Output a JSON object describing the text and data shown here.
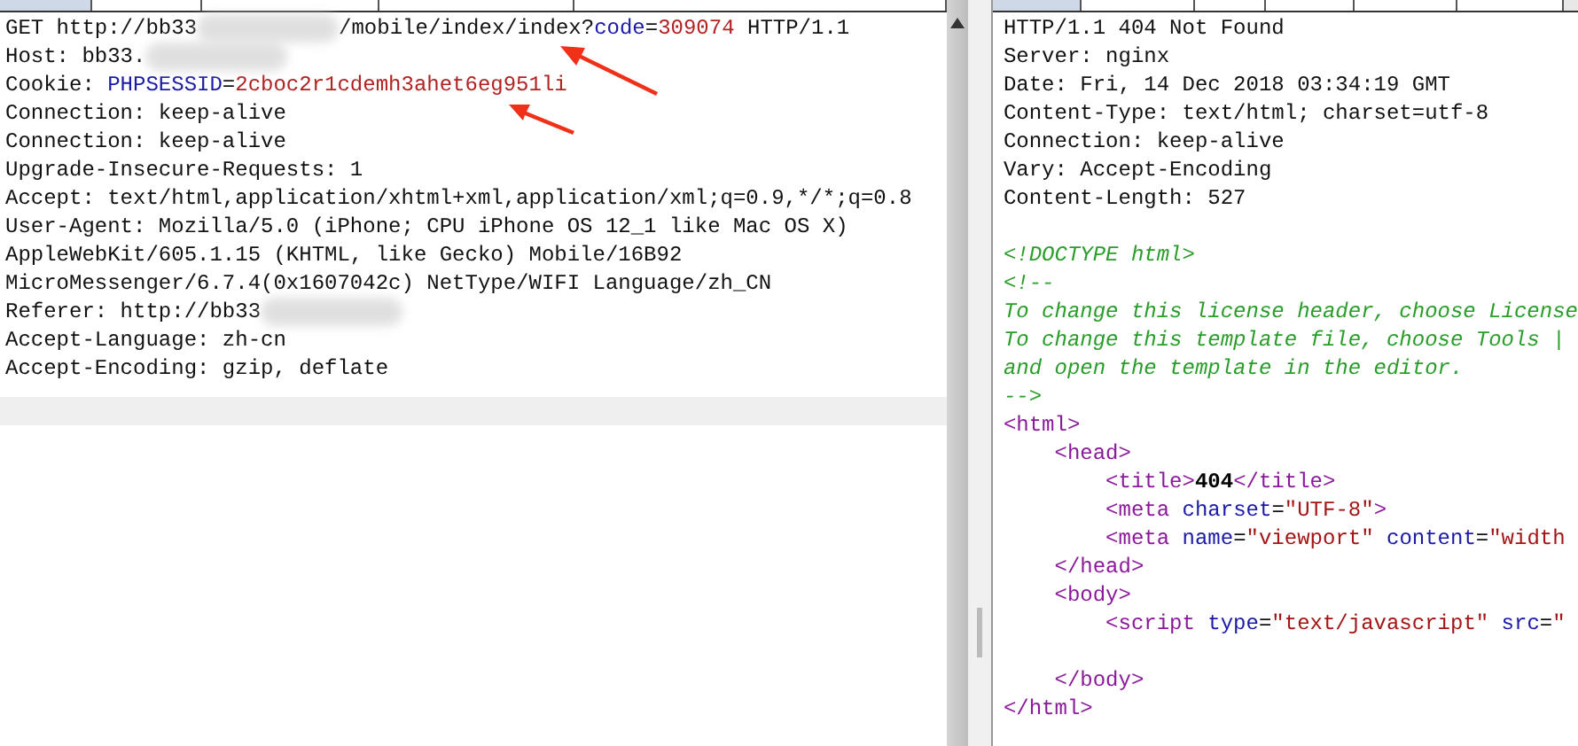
{
  "request": {
    "tabs": [
      {
        "selected": true
      },
      {
        "selected": false
      },
      {
        "selected": false
      },
      {
        "selected": false
      },
      {
        "selected": false
      }
    ],
    "lines": [
      {
        "kind": "code",
        "segments": [
          {
            "kind": "plain",
            "text": "GET http://bb33"
          },
          {
            "kind": "redacted"
          },
          {
            "kind": "plain",
            "text": "/mobile/index/index?"
          },
          {
            "kind": "name",
            "text": "code"
          },
          {
            "kind": "plain",
            "text": "="
          },
          {
            "kind": "value",
            "text": "309074"
          },
          {
            "kind": "plain",
            "text": " HTTP/1.1"
          }
        ]
      },
      {
        "kind": "code",
        "segments": [
          {
            "kind": "plain",
            "text": "Host: bb33."
          },
          {
            "kind": "redacted"
          }
        ]
      },
      {
        "kind": "code",
        "segments": [
          {
            "kind": "plain",
            "text": "Cookie: "
          },
          {
            "kind": "name",
            "text": "PHPSESSID"
          },
          {
            "kind": "plain",
            "text": "="
          },
          {
            "kind": "value",
            "text": "2cboc2r1cdemh3ahet6eg951li"
          }
        ]
      },
      {
        "kind": "code",
        "segments": [
          {
            "kind": "plain",
            "text": "Connection: keep-alive"
          }
        ]
      },
      {
        "kind": "code",
        "segments": [
          {
            "kind": "plain",
            "text": "Connection: keep-alive"
          }
        ]
      },
      {
        "kind": "code",
        "segments": [
          {
            "kind": "plain",
            "text": "Upgrade-Insecure-Requests: 1"
          }
        ]
      },
      {
        "kind": "code",
        "segments": [
          {
            "kind": "plain",
            "text": "Accept: text/html,application/xhtml+xml,application/xml;q=0.9,*/*;q=0.8"
          }
        ]
      },
      {
        "kind": "code",
        "segments": [
          {
            "kind": "plain",
            "text": "User-Agent: Mozilla/5.0 (iPhone; CPU iPhone OS 12_1 like Mac OS X)"
          }
        ]
      },
      {
        "kind": "code",
        "segments": [
          {
            "kind": "plain",
            "text": "AppleWebKit/605.1.15 (KHTML, like Gecko) Mobile/16B92"
          }
        ]
      },
      {
        "kind": "code",
        "segments": [
          {
            "kind": "plain",
            "text": "MicroMessenger/6.7.4(0x1607042c) NetType/WIFI Language/zh_CN"
          }
        ]
      },
      {
        "kind": "code",
        "segments": [
          {
            "kind": "plain",
            "text": "Referer: http://bb33"
          },
          {
            "kind": "redacted"
          }
        ]
      },
      {
        "kind": "code",
        "segments": [
          {
            "kind": "plain",
            "text": "Accept-Language: zh-cn"
          }
        ]
      },
      {
        "kind": "code",
        "segments": [
          {
            "kind": "plain",
            "text": "Accept-Encoding: gzip, deflate"
          }
        ]
      }
    ]
  },
  "response": {
    "tabs": [
      {
        "selected": true
      },
      {
        "selected": false
      },
      {
        "selected": false
      },
      {
        "selected": false
      },
      {
        "selected": false
      },
      {
        "selected": false
      }
    ],
    "lines": [
      {
        "kind": "code",
        "segments": [
          {
            "kind": "plain",
            "text": "HTTP/1.1 404 Not Found"
          }
        ]
      },
      {
        "kind": "code",
        "segments": [
          {
            "kind": "plain",
            "text": "Server: nginx"
          }
        ]
      },
      {
        "kind": "code",
        "segments": [
          {
            "kind": "plain",
            "text": "Date: Fri, 14 Dec 2018 03:34:19 GMT"
          }
        ]
      },
      {
        "kind": "code",
        "segments": [
          {
            "kind": "plain",
            "text": "Content-Type: text/html; charset=utf-8"
          }
        ]
      },
      {
        "kind": "code",
        "segments": [
          {
            "kind": "plain",
            "text": "Connection: keep-alive"
          }
        ]
      },
      {
        "kind": "code",
        "segments": [
          {
            "kind": "plain",
            "text": "Vary: Accept-Encoding"
          }
        ]
      },
      {
        "kind": "code",
        "segments": [
          {
            "kind": "plain",
            "text": "Content-Length: 527"
          }
        ]
      },
      {
        "kind": "blank"
      },
      {
        "kind": "code",
        "segments": [
          {
            "kind": "comment",
            "text": "<!DOCTYPE html>"
          }
        ]
      },
      {
        "kind": "code",
        "segments": [
          {
            "kind": "comment",
            "text": "<!--"
          }
        ]
      },
      {
        "kind": "code",
        "segments": [
          {
            "kind": "comment",
            "text": "To change this license header, choose License"
          }
        ]
      },
      {
        "kind": "code",
        "segments": [
          {
            "kind": "comment",
            "text": "To change this template file, choose Tools |"
          }
        ]
      },
      {
        "kind": "code",
        "segments": [
          {
            "kind": "comment",
            "text": "and open the template in the editor."
          }
        ]
      },
      {
        "kind": "code",
        "segments": [
          {
            "kind": "comment",
            "text": "-->"
          }
        ]
      },
      {
        "kind": "code",
        "segments": [
          {
            "kind": "tag",
            "text": "<html>"
          }
        ]
      },
      {
        "kind": "code",
        "segments": [
          {
            "kind": "tag",
            "text": "    <head>"
          }
        ]
      },
      {
        "kind": "code",
        "segments": [
          {
            "kind": "tag",
            "text": "        <title>"
          },
          {
            "kind": "bold",
            "text": "404"
          },
          {
            "kind": "tag",
            "text": "</title>"
          }
        ]
      },
      {
        "kind": "code",
        "segments": [
          {
            "kind": "tag",
            "text": "        <meta "
          },
          {
            "kind": "attr",
            "text": "charset"
          },
          {
            "kind": "plain",
            "text": "="
          },
          {
            "kind": "string",
            "text": "\"UTF-8\""
          },
          {
            "kind": "tag",
            "text": ">"
          }
        ]
      },
      {
        "kind": "code",
        "segments": [
          {
            "kind": "tag",
            "text": "        <meta "
          },
          {
            "kind": "attr",
            "text": "name"
          },
          {
            "kind": "plain",
            "text": "="
          },
          {
            "kind": "string",
            "text": "\"viewport\""
          },
          {
            "kind": "attr",
            "text": " content"
          },
          {
            "kind": "plain",
            "text": "="
          },
          {
            "kind": "string",
            "text": "\"width"
          }
        ]
      },
      {
        "kind": "code",
        "segments": [
          {
            "kind": "tag",
            "text": "    </head>"
          }
        ]
      },
      {
        "kind": "code",
        "segments": [
          {
            "kind": "tag",
            "text": "    <body>"
          }
        ]
      },
      {
        "kind": "code",
        "segments": [
          {
            "kind": "tag",
            "text": "        <script "
          },
          {
            "kind": "attr",
            "text": "type"
          },
          {
            "kind": "plain",
            "text": "="
          },
          {
            "kind": "string",
            "text": "\"text/javascript\""
          },
          {
            "kind": "attr",
            "text": " src"
          },
          {
            "kind": "plain",
            "text": "="
          },
          {
            "kind": "string",
            "text": "\""
          }
        ]
      },
      {
        "kind": "blank"
      },
      {
        "kind": "code",
        "segments": [
          {
            "kind": "tag",
            "text": "    </body>"
          }
        ]
      },
      {
        "kind": "code",
        "segments": [
          {
            "kind": "tag",
            "text": "</html>"
          }
        ]
      }
    ]
  }
}
